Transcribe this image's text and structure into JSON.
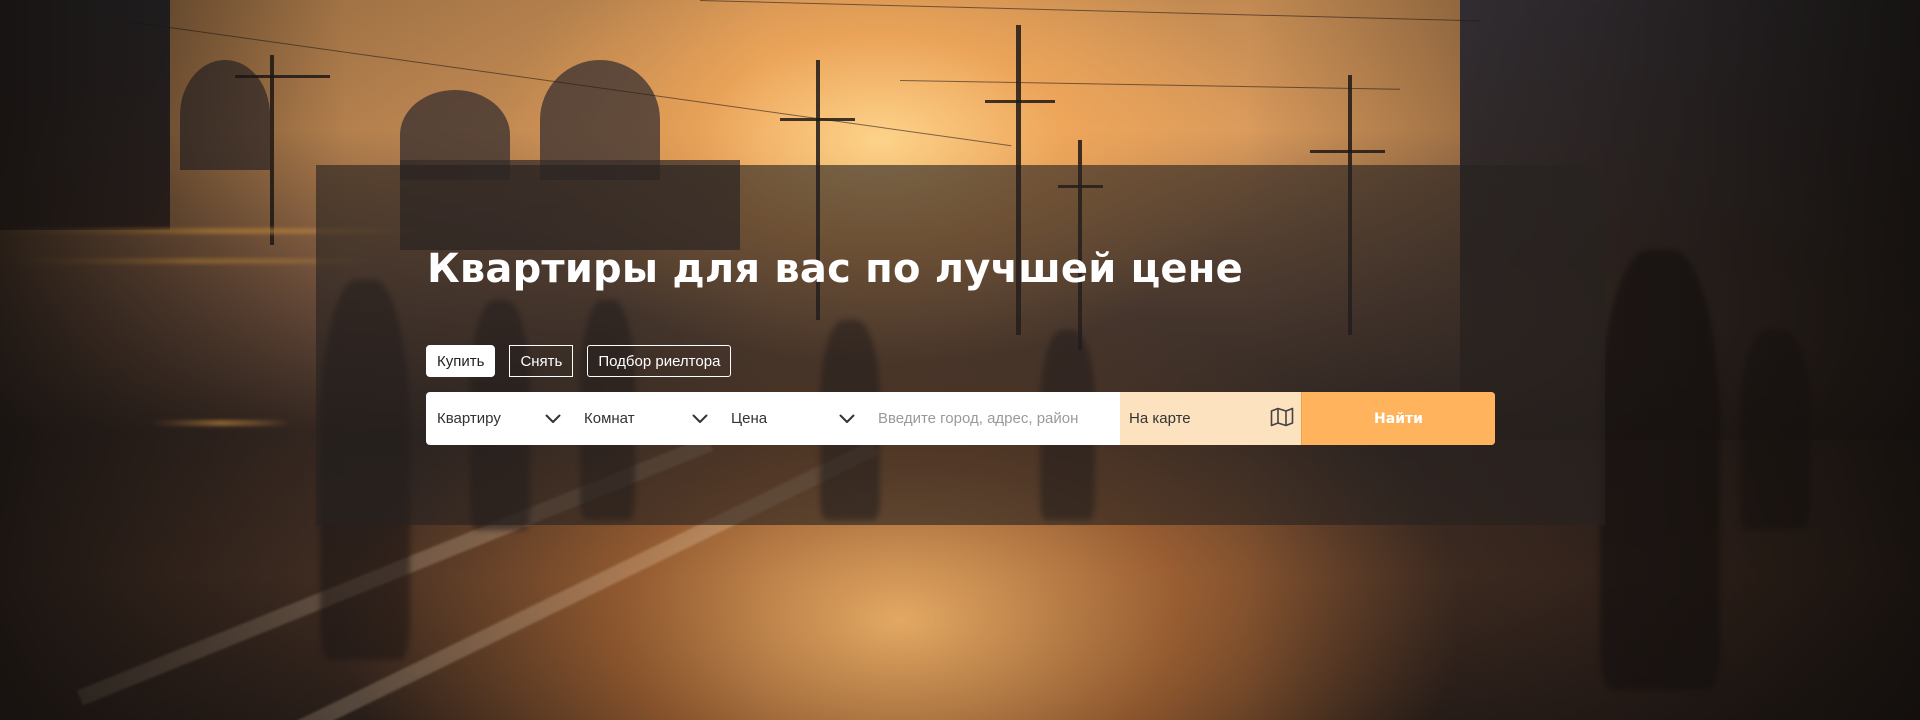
{
  "hero": {
    "title": "Квартиры для вас по лучшей цене"
  },
  "tabs": [
    {
      "label": "Купить",
      "active": true
    },
    {
      "label": "Снять",
      "active": false
    },
    {
      "label": "Подбор риелтора",
      "active": false
    }
  ],
  "search": {
    "property_select": {
      "value": "Квартиру",
      "icon": "chevron-down-icon"
    },
    "rooms_select": {
      "value": "Комнат",
      "icon": "chevron-down-icon"
    },
    "price_select": {
      "value": "Цена",
      "icon": "chevron-down-icon"
    },
    "location_placeholder": "Введите город, адрес, район",
    "map_label": "На карте",
    "map_icon": "map-icon",
    "submit_label": "Найти"
  },
  "colors": {
    "accent": "#ffb35c",
    "map_toggle_bg": "#fde2bf",
    "panel_overlay": "rgba(38,34,32,0.62)"
  }
}
